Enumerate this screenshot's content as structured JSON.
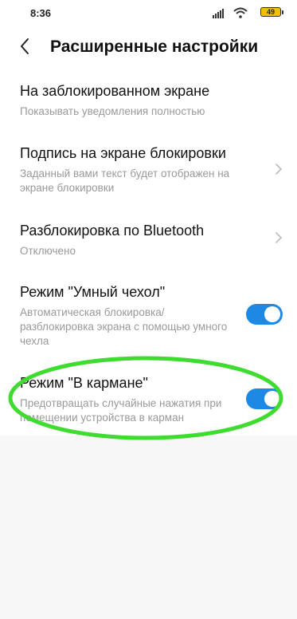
{
  "status_bar": {
    "time": "8:36",
    "battery": "49",
    "icons": [
      "signal-icon",
      "wifi-icon",
      "battery-icon"
    ]
  },
  "header": {
    "back_icon": "chevron-left-icon",
    "title": "Расширенные настройки"
  },
  "settings": [
    {
      "title": "На заблокированном экране",
      "subtitle": "Показывать уведомления полностью",
      "control": "none"
    },
    {
      "title": "Подпись на экране блокировки",
      "subtitle": "Заданный вами текст будет отображен на экране блокировки",
      "control": "chevron"
    },
    {
      "title": "Разблокировка по Bluetooth",
      "subtitle": "Отключено",
      "control": "chevron"
    },
    {
      "title": "Режим \"Умный чехол\"",
      "subtitle": "Автоматическая блокировка/ разблокировка экрана с помощью умного чехла",
      "control": "toggle",
      "enabled": true
    },
    {
      "title": "Режим \"В кармане\"",
      "subtitle": "Предотвращать случайные нажатия при помещении устройства в карман",
      "control": "toggle",
      "enabled": true
    }
  ],
  "colors": {
    "toggle_on": "#1e88e5",
    "highlight": "#3ddc2e",
    "subtitle": "#999999"
  }
}
